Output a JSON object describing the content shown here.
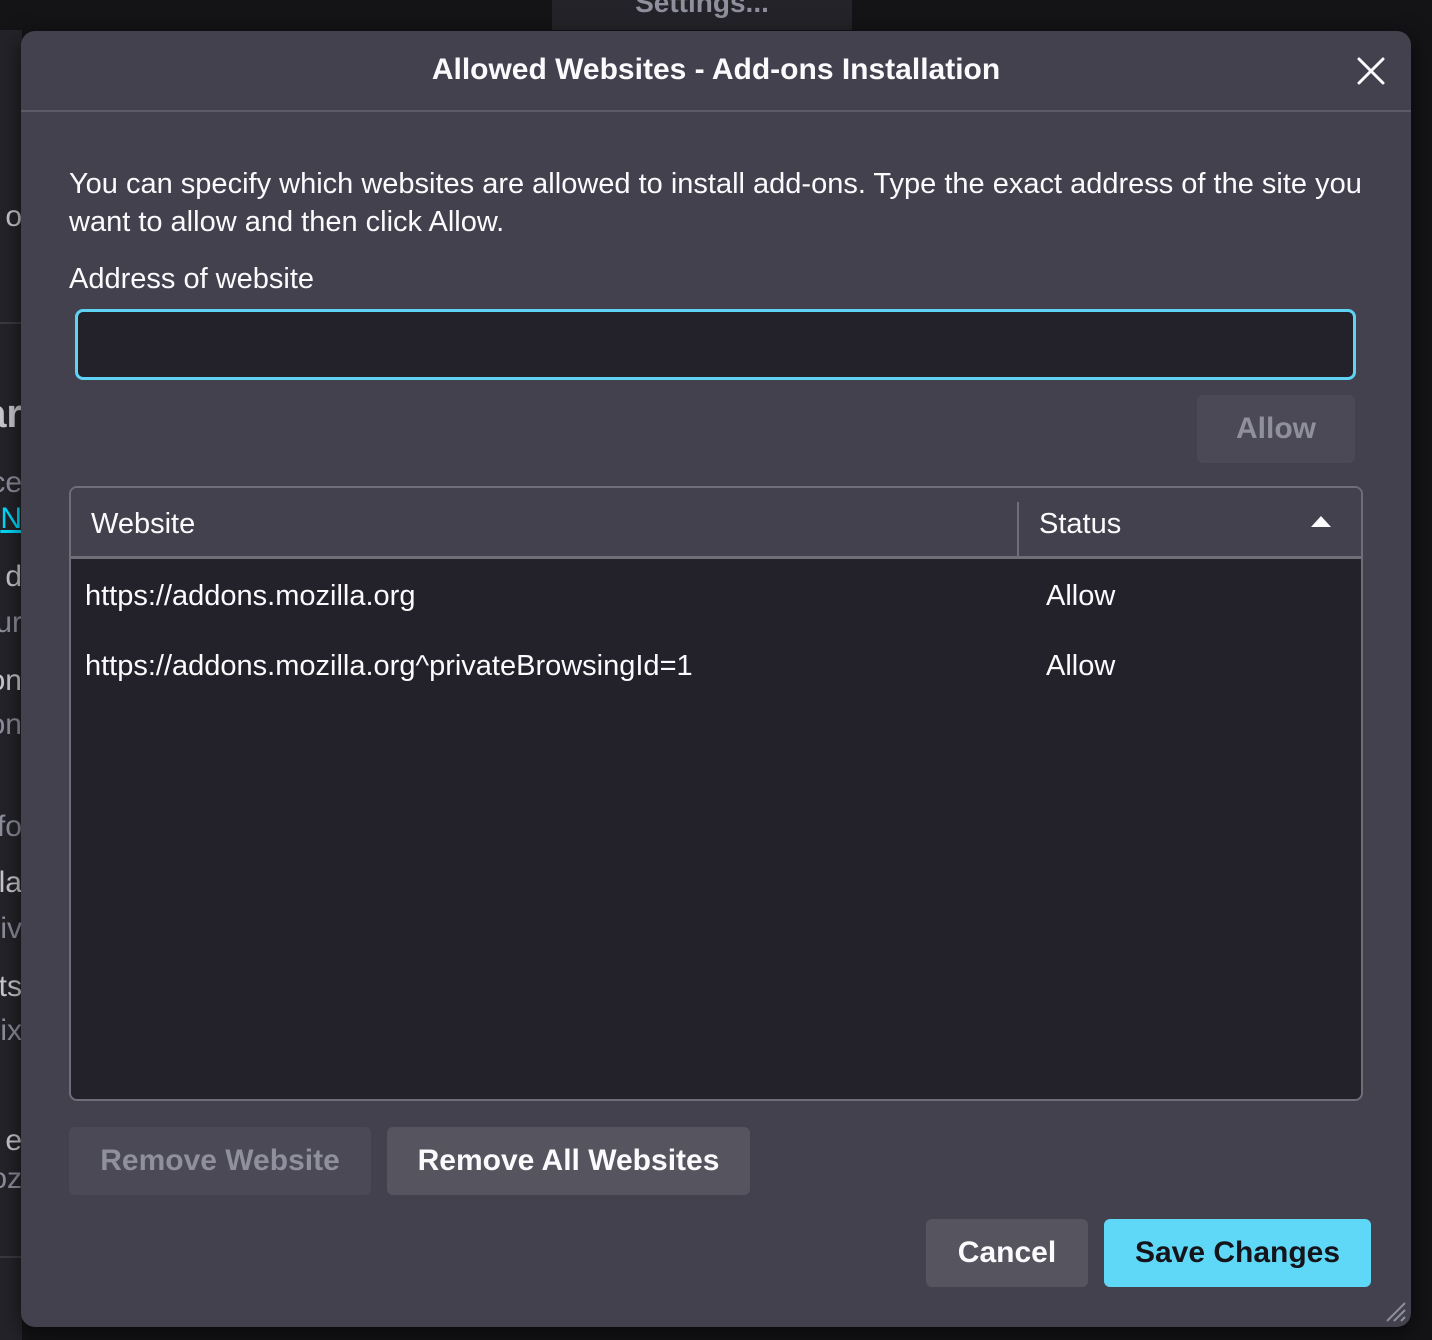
{
  "background": {
    "tab_title": "Settings...",
    "fragments": [
      "o",
      "ar",
      "ce",
      "N",
      "d",
      "ur",
      "on",
      "on",
      "fo",
      "la",
      "iv",
      "rts",
      "ix",
      "e",
      "oz"
    ]
  },
  "dialog": {
    "title": "Allowed Websites - Add-ons Installation",
    "close_icon": "close-icon",
    "description": "You can specify which websites are allowed to install add-ons. Type the exact address of the site you want to allow and then click Allow.",
    "address_label": "Address of website",
    "address_value": "",
    "allow_button": "Allow",
    "table": {
      "columns": [
        "Website",
        "Status"
      ],
      "sort_icon": "sort-ascending-icon",
      "rows": [
        {
          "website": "https://addons.mozilla.org",
          "status": "Allow"
        },
        {
          "website": "https://addons.mozilla.org^privateBrowsingId=1",
          "status": "Allow"
        }
      ]
    },
    "remove_website_button": "Remove Website",
    "remove_all_button": "Remove All Websites",
    "cancel_button": "Cancel",
    "save_button": "Save Changes"
  },
  "colors": {
    "accent": "#5fd8f8",
    "dialog_bg": "#42414d",
    "list_bg": "#23222b"
  }
}
